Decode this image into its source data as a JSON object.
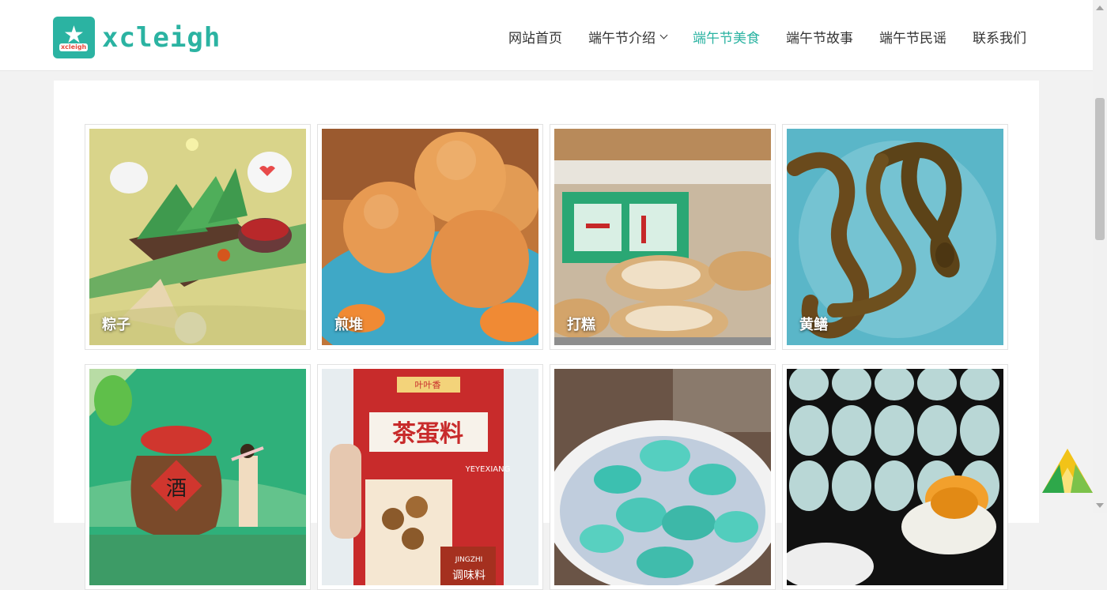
{
  "brand": {
    "name": "xcleigh",
    "badge_text": "xcleigh"
  },
  "nav": {
    "items": [
      {
        "label": "网站首页"
      },
      {
        "label": "端午节介绍"
      },
      {
        "label": "端午节美食"
      },
      {
        "label": "端午节故事"
      },
      {
        "label": "端午节民谣"
      },
      {
        "label": "联系我们"
      }
    ],
    "active_index": 2
  },
  "gallery": {
    "items": [
      {
        "title": "粽子",
        "icon": "zongzi-image"
      },
      {
        "title": "煎堆",
        "icon": "sesame-ball-image"
      },
      {
        "title": "打糕",
        "icon": "rice-cake-image"
      },
      {
        "title": "黄鳝",
        "icon": "eel-image"
      },
      {
        "title": "",
        "icon": "wine-jar-image",
        "jar_label": "酒"
      },
      {
        "title": "",
        "icon": "tea-egg-seasoning-image",
        "package_text": [
          "叶叶香",
          "茶蛋料",
          "YEYEXIANG",
          "JINGZHI",
          "调味料"
        ]
      },
      {
        "title": "",
        "icon": "laba-garlic-image"
      },
      {
        "title": "",
        "icon": "salted-duck-egg-image"
      }
    ]
  },
  "colors": {
    "accent": "#2bb3a2",
    "nav_text": "#333333",
    "page_bg": "#f2f2f2"
  }
}
